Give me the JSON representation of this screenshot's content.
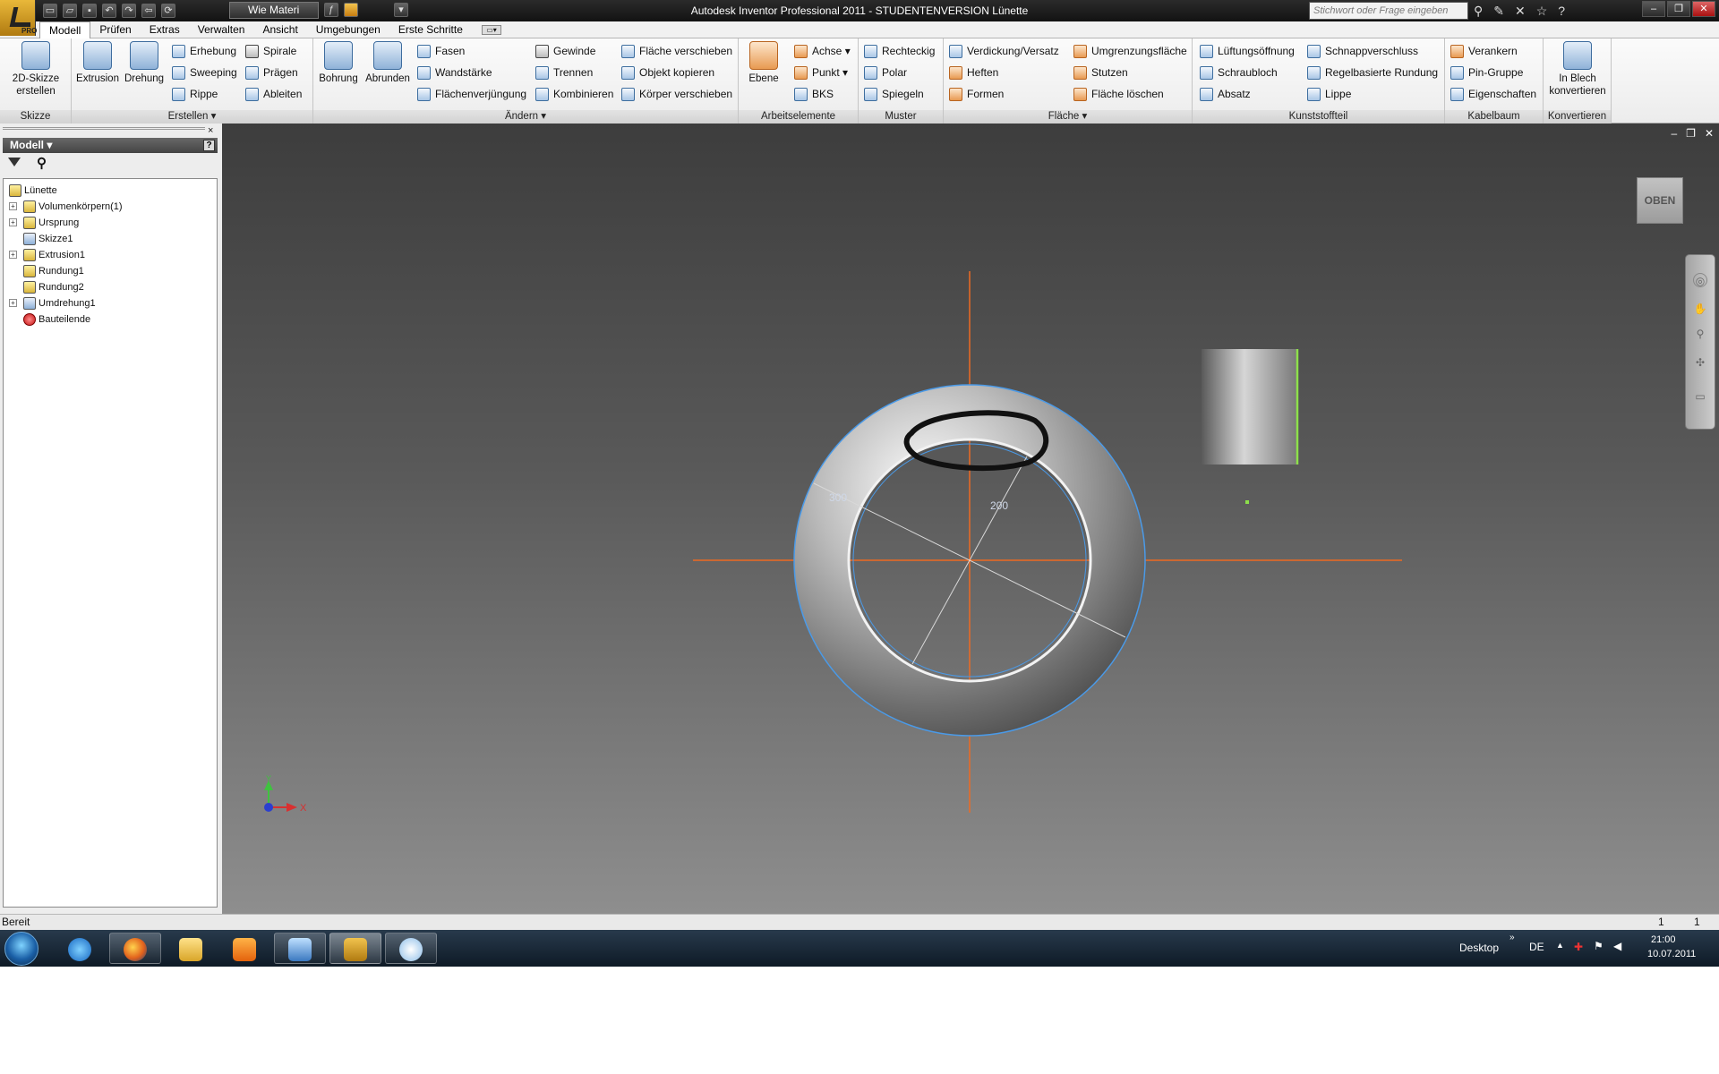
{
  "window": {
    "title": "Autodesk Inventor Professional 2011 - STUDENTENVERSION   Lünette",
    "pro_badge": "PRO"
  },
  "qat": {
    "material": "Wie Materi",
    "icons": [
      "new-icon",
      "open-icon",
      "save-icon",
      "undo-icon",
      "redo-icon",
      "return-icon",
      "update-icon",
      "fx-icon",
      "color-icon"
    ]
  },
  "help": {
    "search_placeholder": "Stichwort oder Frage eingeben"
  },
  "tabs": [
    "Modell",
    "Prüfen",
    "Extras",
    "Verwalten",
    "Ansicht",
    "Umgebungen",
    "Erste Schritte"
  ],
  "ribbon": {
    "skizze": {
      "title": "Skizze",
      "create_sketch": "2D-Skizze\nerstellen"
    },
    "erstellen": {
      "title": "Erstellen",
      "extrusion": "Extrusion",
      "drehung": "Drehung",
      "erhebung": "Erhebung",
      "sweeping": "Sweeping",
      "rippe": "Rippe",
      "spirale": "Spirale",
      "praegen": "Prägen",
      "ableiten": "Ableiten"
    },
    "aendern": {
      "title": "Ändern",
      "bohrung": "Bohrung",
      "abrunden": "Abrunden",
      "fasen": "Fasen",
      "wandstaerke": "Wandstärke",
      "flaechenverjuengung": "Flächenverjüngung",
      "gewinde": "Gewinde",
      "trennen": "Trennen",
      "kombinieren": "Kombinieren",
      "flaeche_verschieben": "Fläche verschieben",
      "objekt_kopieren": "Objekt kopieren",
      "koerper_verschieben": "Körper verschieben"
    },
    "arbeitselemente": {
      "title": "Arbeitselemente",
      "ebene": "Ebene",
      "achse": "Achse",
      "punkt": "Punkt",
      "bks": "BKS"
    },
    "muster": {
      "title": "Muster",
      "rechteckig": "Rechteckig",
      "polar": "Polar",
      "spiegeln": "Spiegeln"
    },
    "flaeche": {
      "title": "Fläche",
      "verdickung": "Verdickung/Versatz",
      "heften": "Heften",
      "formen": "Formen",
      "umgrenzung": "Umgrenzungsfläche",
      "stutzen": "Stutzen",
      "flaeche_loeschen": "Fläche löschen"
    },
    "kunststoff": {
      "title": "Kunststoffteil",
      "lueftung": "Lüftungsöffnung",
      "schraubloch": "Schraubloch",
      "absatz": "Absatz",
      "schnappverschluss": "Schnappverschluss",
      "regelbasiert": "Regelbasierte Rundung",
      "lippe": "Lippe"
    },
    "kabelbaum": {
      "title": "Kabelbaum",
      "verankern": "Verankern",
      "pin_gruppe": "Pin-Gruppe",
      "eigenschaften": "Eigenschaften"
    },
    "konvertieren": {
      "title": "Konvertieren",
      "in_blech": "In Blech\nkonvertieren"
    }
  },
  "browser": {
    "header": "Modell",
    "help": "?",
    "close": "×",
    "tree": [
      {
        "label": "Lünette",
        "icon": "part-icon"
      },
      {
        "label": "Volumenkörpern(1)",
        "icon": "solid-bodies-icon"
      },
      {
        "label": "Ursprung",
        "icon": "folder-icon"
      },
      {
        "label": "Skizze1",
        "icon": "sketch-icon"
      },
      {
        "label": "Extrusion1",
        "icon": "extrusion-icon"
      },
      {
        "label": "Rundung1",
        "icon": "fillet-icon"
      },
      {
        "label": "Rundung2",
        "icon": "fillet-icon"
      },
      {
        "label": "Umdrehung1",
        "icon": "revolve-icon"
      },
      {
        "label": "Bauteilende",
        "icon": "end-of-part-icon"
      }
    ]
  },
  "viewport": {
    "viewcube": "OBEN",
    "dim_outer": "300",
    "dim_inner": "200",
    "axis_x": "X",
    "axis_y": "Y"
  },
  "status": {
    "text": "Bereit",
    "count1": "1",
    "count2": "1"
  },
  "taskbar": {
    "apps": [
      "internet-explorer-icon",
      "firefox-icon",
      "explorer-icon",
      "media-player-icon",
      "remote-desktop-icon",
      "inventor-icon",
      "paint-icon"
    ],
    "desktop": "Desktop",
    "lang": "DE",
    "time": "21:00",
    "date": "10.07.2011"
  },
  "colors": {
    "axis": "#ee6a22",
    "edge": "#4a9ae8",
    "accent": "#8de04a"
  }
}
